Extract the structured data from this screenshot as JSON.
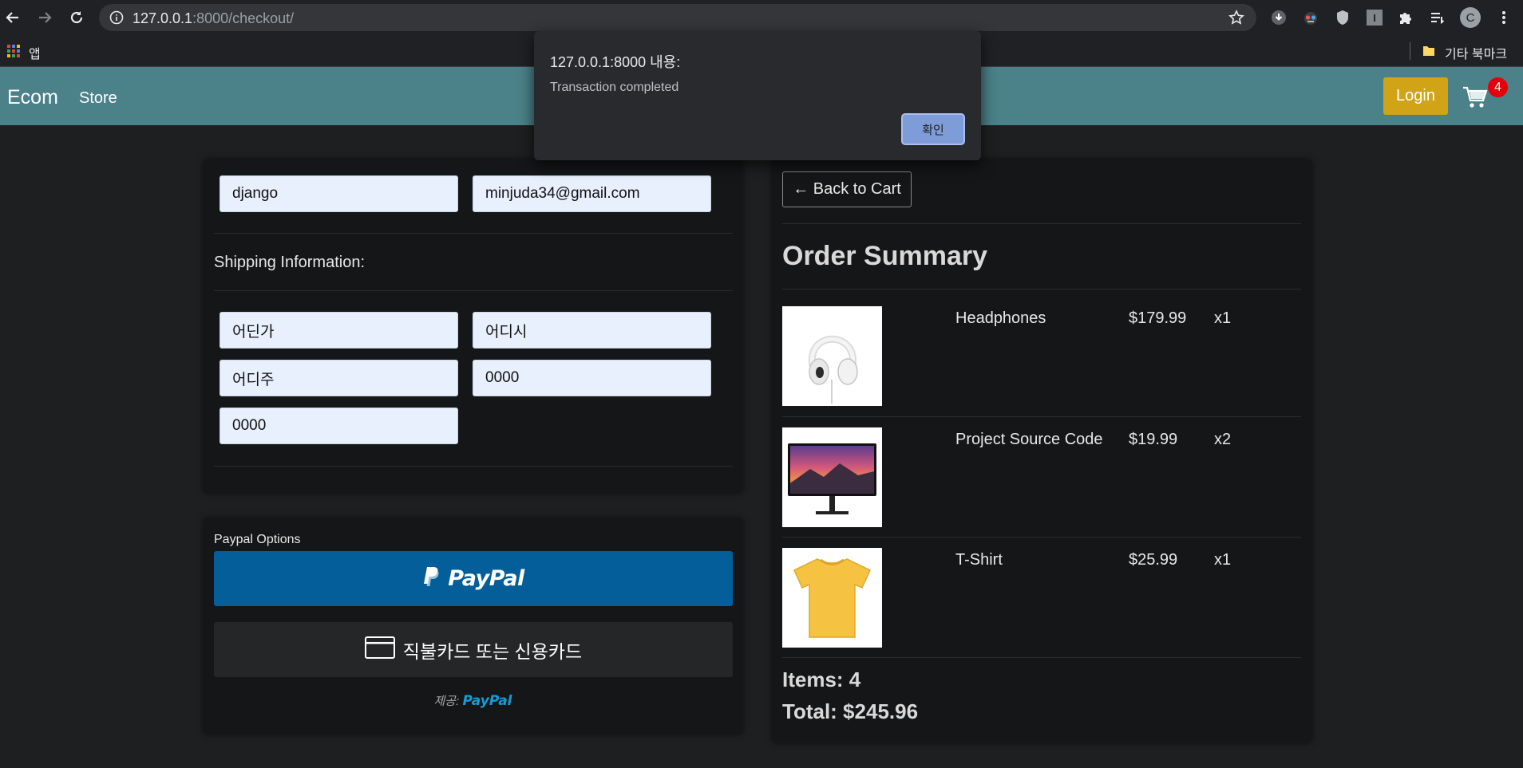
{
  "browser": {
    "url_host": "127.0.0.1",
    "url_path": ":8000/checkout/",
    "apps_label": "앱",
    "bookmarks_label": "기타 북마크",
    "profile_initial": "C",
    "ext_letter": "I"
  },
  "navbar": {
    "brand": "Ecom",
    "store_link": "Store",
    "login_label": "Login",
    "cart_count": "4",
    "login_color": "#d1a316",
    "navbar_color": "#4b8188"
  },
  "form": {
    "name": "django",
    "email": "minjuda34@gmail.com",
    "shipping_label": "Shipping Information:",
    "address": "어딘가",
    "city": "어디시",
    "state": "어디주",
    "zipcode": "0000",
    "country": "0000"
  },
  "payment": {
    "options_label": "Paypal Options",
    "paypal_button": "PayPal",
    "card_button": "직불카드 또는 신용카드",
    "powered_by": "제공:",
    "powered_brand": "PayPal",
    "paypal_color": "#045e99"
  },
  "summary": {
    "back_label": "← Back to Cart",
    "title": "Order Summary",
    "items": [
      {
        "name": "Headphones",
        "price": "$179.99",
        "qty": "x1"
      },
      {
        "name": "Project Source Code",
        "price": "$19.99",
        "qty": "x2"
      },
      {
        "name": "T-Shirt",
        "price": "$25.99",
        "qty": "x1"
      }
    ],
    "items_total": "Items: 4",
    "price_total": "Total: $245.96"
  },
  "dialog": {
    "title": "127.0.0.1:8000 내용:",
    "message": "Transaction completed",
    "ok_label": "확인"
  }
}
